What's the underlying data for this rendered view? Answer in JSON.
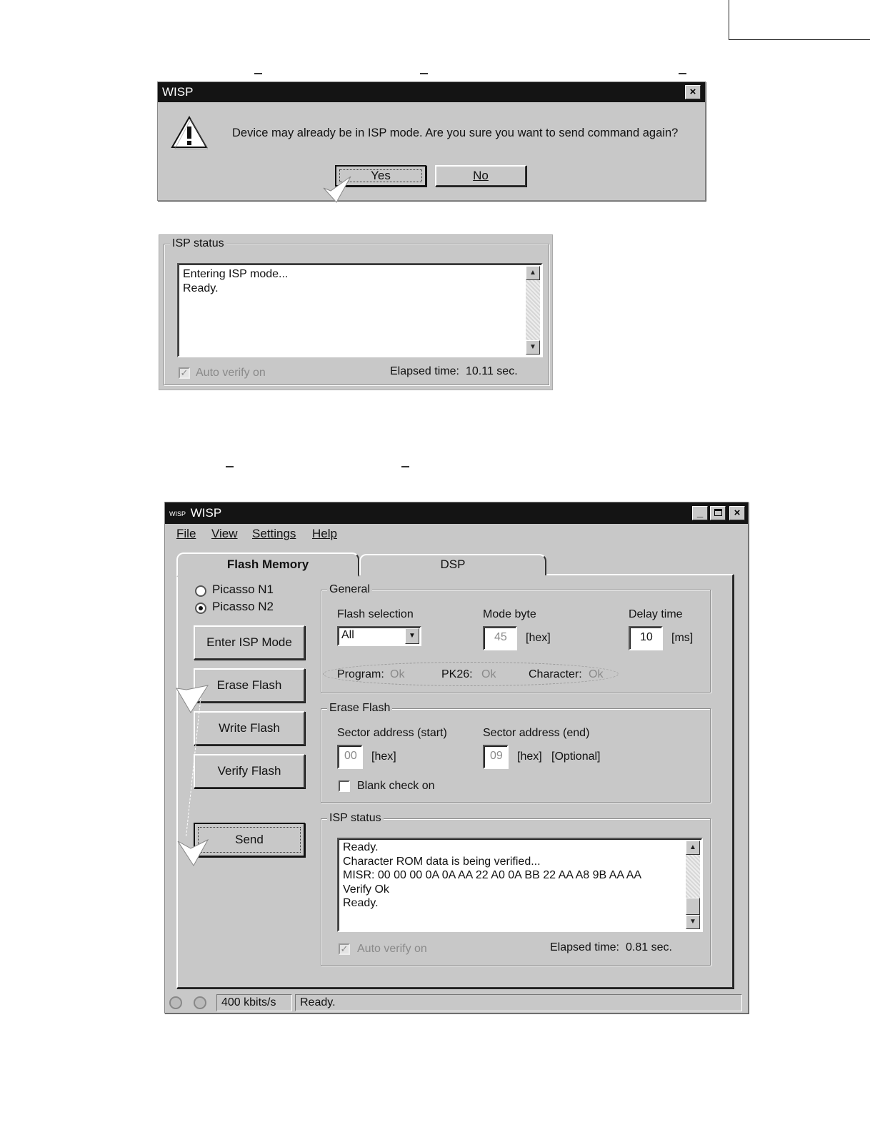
{
  "confirm_dialog": {
    "title": "WISP",
    "message": "Device may already be in ISP mode. Are you sure you want to send command again?",
    "yes_label": "Yes",
    "no_label": "No",
    "close_glyph": "×"
  },
  "isp_status_small": {
    "group_label": "ISP status",
    "lines": [
      "Entering ISP mode...",
      "Ready."
    ],
    "auto_verify_label": "Auto verify on",
    "elapsed_label": "Elapsed time:",
    "elapsed_value": "10.11 sec."
  },
  "main_window": {
    "title_icon": "WISP",
    "title": "WISP",
    "menu": [
      "File",
      "View",
      "Settings",
      "Help"
    ],
    "tabs": [
      {
        "label": "Flash Memory",
        "active": true
      },
      {
        "label": "DSP",
        "active": false
      }
    ],
    "radios": [
      {
        "label": "Picasso N1",
        "checked": false
      },
      {
        "label": "Picasso N2",
        "checked": true
      }
    ],
    "buttons": {
      "enter_isp": "Enter ISP Mode",
      "erase_flash": "Erase Flash",
      "write_flash": "Write Flash",
      "verify_flash": "Verify Flash",
      "send": "Send"
    },
    "general": {
      "group_label": "General",
      "flash_selection_label": "Flash selection",
      "flash_selection_value": "All",
      "mode_byte_label": "Mode byte",
      "mode_byte_value": "45",
      "mode_byte_unit": "[hex]",
      "delay_time_label": "Delay time",
      "delay_time_value": "10",
      "delay_time_unit": "[ms]",
      "program_label": "Program:",
      "program_value": "Ok",
      "pk26_label": "PK26:",
      "pk26_value": "Ok",
      "character_label": "Character:",
      "character_value": "Ok"
    },
    "erase": {
      "group_label": "Erase Flash",
      "start_label": "Sector address (start)",
      "start_value": "00",
      "start_unit": "[hex]",
      "end_label": "Sector address (end)",
      "end_value": "09",
      "end_unit": "[hex]",
      "optional": "[Optional]",
      "blank_check_label": "Blank check on"
    },
    "isp_status": {
      "group_label": "ISP status",
      "lines": [
        "Ready.",
        "Character ROM data is being verified...",
        "MISR: 00 00 00 0A 0A AA 22 A0 0A BB 22 AA A8 9B AA AA",
        "Verify Ok",
        "Ready."
      ],
      "auto_verify_label": "Auto verify on",
      "elapsed_label": "Elapsed time:",
      "elapsed_value": "0.81 sec."
    },
    "statusbar": {
      "speed": "400 kbits/s",
      "message": "Ready."
    }
  }
}
